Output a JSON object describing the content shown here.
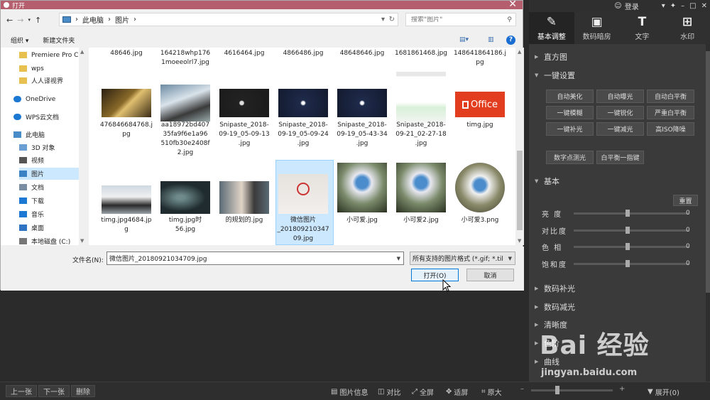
{
  "dialog": {
    "title": "打开",
    "breadcrumb": [
      "此电脑",
      "图片"
    ],
    "search_placeholder": "搜索\"图片\"",
    "toolbar": {
      "organize": "组织 ▾",
      "new_folder": "新建文件夹"
    },
    "sidebar": [
      {
        "label": "Premiere Pro C",
        "icon": "folder-icon"
      },
      {
        "label": "wps",
        "icon": "folder-icon"
      },
      {
        "label": "人人译视界",
        "icon": "folder-icon"
      },
      {
        "label": "OneDrive",
        "icon": "cloud-icon"
      },
      {
        "label": "WPS云文档",
        "icon": "cloud-icon"
      },
      {
        "label": "此电脑",
        "icon": "computer-icon"
      },
      {
        "label": "3D 对象",
        "icon": "cube-icon"
      },
      {
        "label": "视频",
        "icon": "video-icon"
      },
      {
        "label": "图片",
        "icon": "pictures-icon"
      },
      {
        "label": "文档",
        "icon": "document-icon"
      },
      {
        "label": "下载",
        "icon": "download-icon"
      },
      {
        "label": "音乐",
        "icon": "music-icon"
      },
      {
        "label": "桌面",
        "icon": "desktop-icon"
      },
      {
        "label": "本地磁盘 (C:)",
        "icon": "disk-icon"
      }
    ],
    "files_row0": [
      "48646.jpg",
      "164218whp176\n1moeeolrl7.jpg",
      "4616464.jpg",
      "4866486.jpg",
      "48648646.jpg",
      "1681861468.jpg",
      "148641864186.j\npg"
    ],
    "files_row1": [
      "476846684768.j\npg",
      "aa18972bd407\n35fa9f6e1a96\n510fb30e2408f\n2.jpg",
      "Snipaste_2018-\n09-19_05-09-13\n.jpg",
      "Snipaste_2018-\n09-19_05-09-24\n.jpg",
      "Snipaste_2018-\n09-19_05-43-34\n.jpg",
      "Snipaste_2018-\n09-21_02-27-18\n.jpg",
      "timg.jpg"
    ],
    "files_row2": [
      "timg.jpg4684.jp\ng",
      "timg.jpg时\n56.jpg",
      "的规划的.jpg",
      "微信图片\n_201809210347\n09.jpg",
      "小可爱.jpg",
      "小可爱2.jpg",
      "小可爱3.png"
    ],
    "office_label": "Office",
    "filename_label": "文件名(N):",
    "filename_value": "微信图片_20180921034709.jpg",
    "filetype_value": "所有支持的图片格式 (*.gif; *.til",
    "open_button": "打开(O)",
    "cancel_button": "取消"
  },
  "panel": {
    "login": "登录",
    "tabs": [
      "基本调整",
      "数码暗房",
      "文字",
      "水印"
    ],
    "sections": {
      "histogram": "直方图",
      "one_click": "一键设置",
      "basic": "基本",
      "digital_fill": "数码补光",
      "digital_reduce": "数码减光",
      "clarity": "清晰度",
      "color_partial": "色阶",
      "curve_partial": "曲线"
    },
    "one_click_buttons": [
      "自动美化",
      "自动曝光",
      "自动白平衡",
      "一键模糊",
      "一键锐化",
      "严重白平衡",
      "一键补光",
      "一键减光",
      "高ISO降噪"
    ],
    "extra_buttons": [
      "数字点测光",
      "白平衡一指键"
    ],
    "reset": "重置",
    "sliders": [
      {
        "label": "亮 度",
        "value": 0,
        "text": "0"
      },
      {
        "label": "对比度",
        "value": 0,
        "text": "0"
      },
      {
        "label": "色 相",
        "value": 0,
        "text": "0"
      },
      {
        "label": "饱和度",
        "value": 0,
        "text": "0"
      }
    ]
  },
  "bottom_bar": {
    "prev": "上一张",
    "next": "下一张",
    "delete": "删除",
    "info": "图片信息",
    "compare": "对比",
    "fullscreen": "全屏",
    "fit": "适屏",
    "original": "原大",
    "expand": "展开(0)"
  },
  "watermark": {
    "logo": "Bai 经验",
    "url": "jingyan.baidu.com"
  }
}
